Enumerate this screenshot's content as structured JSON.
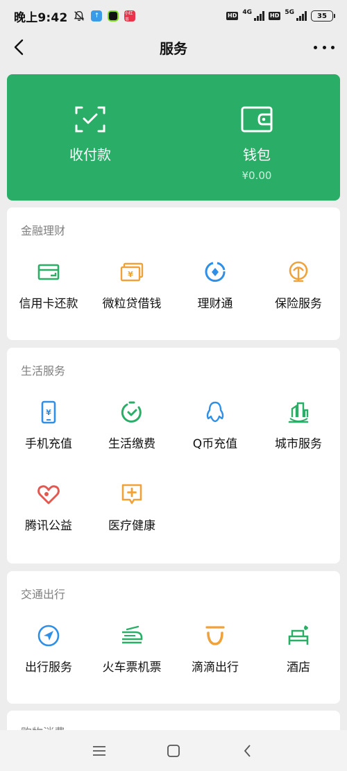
{
  "status_bar": {
    "time": "晚上9:42",
    "app3_label": "小红书",
    "hd1": "HD",
    "net1": "4G",
    "hd2": "HD",
    "net2": "5G",
    "battery": "35"
  },
  "nav": {
    "title": "服务"
  },
  "wallet_card": {
    "pay": {
      "label": "收付款",
      "icon": "scan-pay-icon"
    },
    "wallet": {
      "label": "钱包",
      "balance": "¥0.00",
      "icon": "wallet-icon"
    }
  },
  "sections": [
    {
      "title": "金融理财",
      "items": [
        {
          "label": "信用卡还款",
          "icon": "credit-card-icon",
          "color": "#2aae67"
        },
        {
          "label": "微粒贷借钱",
          "icon": "yuan-bill-icon",
          "color": "#f0a23a"
        },
        {
          "label": "理财通",
          "icon": "wealth-icon",
          "color": "#2f8fe6"
        },
        {
          "label": "保险服务",
          "icon": "umbrella-icon",
          "color": "#f0a23a"
        }
      ]
    },
    {
      "title": "生活服务",
      "items": [
        {
          "label": "手机充值",
          "icon": "mobile-topup-icon",
          "color": "#2f8fe6"
        },
        {
          "label": "生活缴费",
          "icon": "utility-bill-icon",
          "color": "#2aae67"
        },
        {
          "label": "Q币充值",
          "icon": "qq-penguin-icon",
          "color": "#2f8fe6"
        },
        {
          "label": "城市服务",
          "icon": "city-icon",
          "color": "#2aae67"
        },
        {
          "label": "腾讯公益",
          "icon": "charity-heart-icon",
          "color": "#e05a52"
        },
        {
          "label": "医疗健康",
          "icon": "medical-icon",
          "color": "#f0a23a"
        }
      ]
    },
    {
      "title": "交通出行",
      "items": [
        {
          "label": "出行服务",
          "icon": "navigation-icon",
          "color": "#2f8fe6"
        },
        {
          "label": "火车票机票",
          "icon": "train-plane-icon",
          "color": "#2aae67"
        },
        {
          "label": "滴滴出行",
          "icon": "didi-icon",
          "color": "#f0a23a"
        },
        {
          "label": "酒店",
          "icon": "hotel-bed-icon",
          "color": "#2aae67"
        }
      ]
    },
    {
      "title": "购物消费",
      "items": []
    }
  ],
  "colors": {
    "brand_green": "#2aae67",
    "background": "#ededed"
  }
}
